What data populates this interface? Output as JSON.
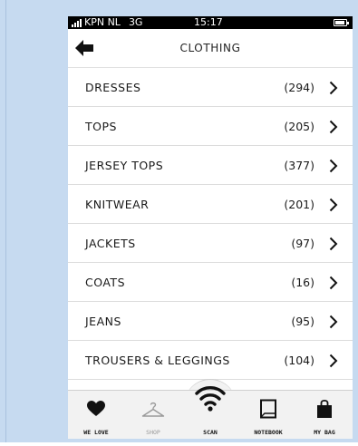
{
  "status_bar": {
    "carrier": "KPN NL",
    "network": "3G",
    "time": "15:17"
  },
  "nav": {
    "title": "CLOTHING"
  },
  "categories": [
    {
      "label": "DRESSES",
      "count": "(294)"
    },
    {
      "label": "TOPS",
      "count": "(205)"
    },
    {
      "label": "JERSEY TOPS",
      "count": "(377)"
    },
    {
      "label": "KNITWEAR",
      "count": "(201)"
    },
    {
      "label": "JACKETS",
      "count": "(97)"
    },
    {
      "label": "COATS",
      "count": "(16)"
    },
    {
      "label": "JEANS",
      "count": "(95)"
    },
    {
      "label": "TROUSERS & LEGGINGS",
      "count": "(104)"
    }
  ],
  "tabs": [
    {
      "label": "WE LOVE",
      "icon": "heart-icon"
    },
    {
      "label": "SHOP",
      "icon": "hanger-icon"
    },
    {
      "label": "SCAN",
      "icon": "wifi-scan-icon"
    },
    {
      "label": "NOTEBOOK",
      "icon": "notebook-icon"
    },
    {
      "label": "MY BAG",
      "icon": "bag-icon"
    }
  ],
  "colors": {
    "frame_background": "#c6daf0",
    "tab_bar": "#f2f2f2",
    "status_bar": "#000000",
    "inactive_tab": "#9a9a9a"
  }
}
